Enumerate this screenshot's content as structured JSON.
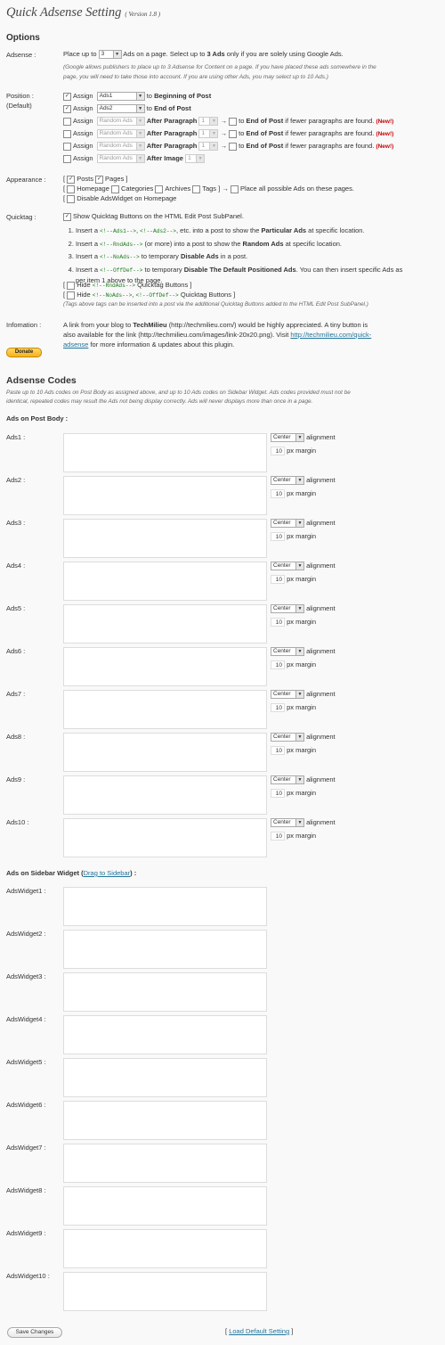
{
  "page_title": "Quick Adsense Setting",
  "version": "( Version 1.8 )",
  "options_heading": "Options",
  "adsense_label": "Adsense :",
  "adsense_line_pre": "Place up to",
  "adsense_count": "3",
  "adsense_line_mid": "Ads on a page. Select up to",
  "adsense_line_bold": "3 Ads",
  "adsense_line_post": "only if you are solely using Google Ads.",
  "adsense_note_1": "(Google allows publishers to place up to 3 Adsense for Content on a page. If you have placed these ads somewhere in the",
  "adsense_note_2": "page, you will need to take those into account. If you are using other Ads, you may select up to 10 Ads.)",
  "position_label": "Position :",
  "position_default": "(Default)",
  "assign": "Assign",
  "pos_rows": [
    {
      "ad": "Ads1",
      "text": "to",
      "target": "Beginning of Post"
    },
    {
      "ad": "Ads2",
      "text": "to",
      "target": "End of Post"
    }
  ],
  "random_ads": "Random Ads",
  "after_paragraph": "After Paragraph",
  "after_image": "After Image",
  "one": "1",
  "arrow_to": "→",
  "to": "to",
  "end_of_post": "End of Post",
  "fewer_text": "if fewer paragraphs are found.",
  "new_badge": "(New!)",
  "appearance_label": "Appearance :",
  "bracket_open": "[",
  "bracket_close": "]",
  "app_posts": "Posts",
  "app_pages": "Pages",
  "app_homepage": "Homepage",
  "app_categories": "Categories",
  "app_archives": "Archives",
  "app_tags": "Tags",
  "app_place_all": "Place all possible Ads on these pages.",
  "app_disable_widget": "Disable AdsWidget on Homepage",
  "quicktag_label": "Quicktag :",
  "qt_show": "Show Quicktag Buttons on the HTML Edit Post SubPanel.",
  "qt_items": {
    "i1_pre": "Insert a",
    "i1_code1": "<!--Ads1-->",
    "i1_comma": ",",
    "i1_code2": "<!--Ads2-->",
    "i1_mid": ", etc. into a post to show the",
    "i1_bold": "Particular Ads",
    "i1_post": "at specific location.",
    "i2_pre": "Insert a",
    "i2_code": "<!--RndAds-->",
    "i2_mid": "(or more) into a post to show the",
    "i2_bold": "Random Ads",
    "i2_post": "at specific location.",
    "i3_pre": "Insert a",
    "i3_code": "<!--NoAds-->",
    "i3_mid": "to temporary",
    "i3_bold": "Disable Ads",
    "i3_post": "in a post.",
    "i4_pre": "Insert a",
    "i4_code": "<!--OffDef-->",
    "i4_mid": "to temporary",
    "i4_bold": "Disable The Default Positioned Ads",
    "i4_post": ". You can then insert specific Ads as",
    "i4_post2": "per item 1 above to the page."
  },
  "hide_word": "Hide",
  "hide1_code": "<!--RndAds-->",
  "hide2_code1": "<!--NoAds-->",
  "hide2_comma": ",",
  "hide2_code2": "<!--OffDef-->",
  "quicktag_buttons": "Quicktag Buttons",
  "qt_note": "(Tags above tags can be inserted into a post via the additional Quicktag Buttons added to the HTML Edit Post SubPanel.)",
  "info_label": "Infomation :",
  "info_1_pre": "A link from your blog to",
  "info_1_bold": "TechMilieu",
  "info_1_post": "(http://techmilieu.com/) would be highly appreciated. A tiny button is",
  "info_2": "also available for the link (http://techmilieu.com/images/link-20x20.png). Visit",
  "info_link_1": "http://techmilieu.com/quick-",
  "info_link_2": "adsense",
  "info_3": "for more information & updates about this plugin.",
  "donate_label": "Donate",
  "codes_heading": "Adsense Codes",
  "codes_note_1": "Paste up to 10 Ads codes on Post Body as assigned above, and up to 10 Ads codes on Sidebar Widget. Ads codes provided must not be",
  "codes_note_2": "identical, repeated codes may result the Ads not being display correctly. Ads will never displays more than once in a page.",
  "post_body_heading": "Ads on Post Body :",
  "align_value": "Center",
  "align_label": "alignment",
  "margin_value": "10",
  "margin_label": "px margin",
  "post_ads": [
    "Ads1 :",
    "Ads2 :",
    "Ads3 :",
    "Ads4 :",
    "Ads5 :",
    "Ads6 :",
    "Ads7 :",
    "Ads8 :",
    "Ads9 :",
    "Ads10 :"
  ],
  "sidebar_heading_pre": "Ads on Sidebar Widget (",
  "sidebar_link": "Drag to Sidebar",
  "sidebar_heading_post": ") :",
  "widget_ads": [
    "AdsWidget1 :",
    "AdsWidget2 :",
    "AdsWidget3 :",
    "AdsWidget4 :",
    "AdsWidget5 :",
    "AdsWidget6 :",
    "AdsWidget7 :",
    "AdsWidget8 :",
    "AdsWidget9 :",
    "AdsWidget10 :"
  ],
  "save_button": "Save Changes",
  "load_default": "Load Default Setting",
  "check_mark": "✓"
}
